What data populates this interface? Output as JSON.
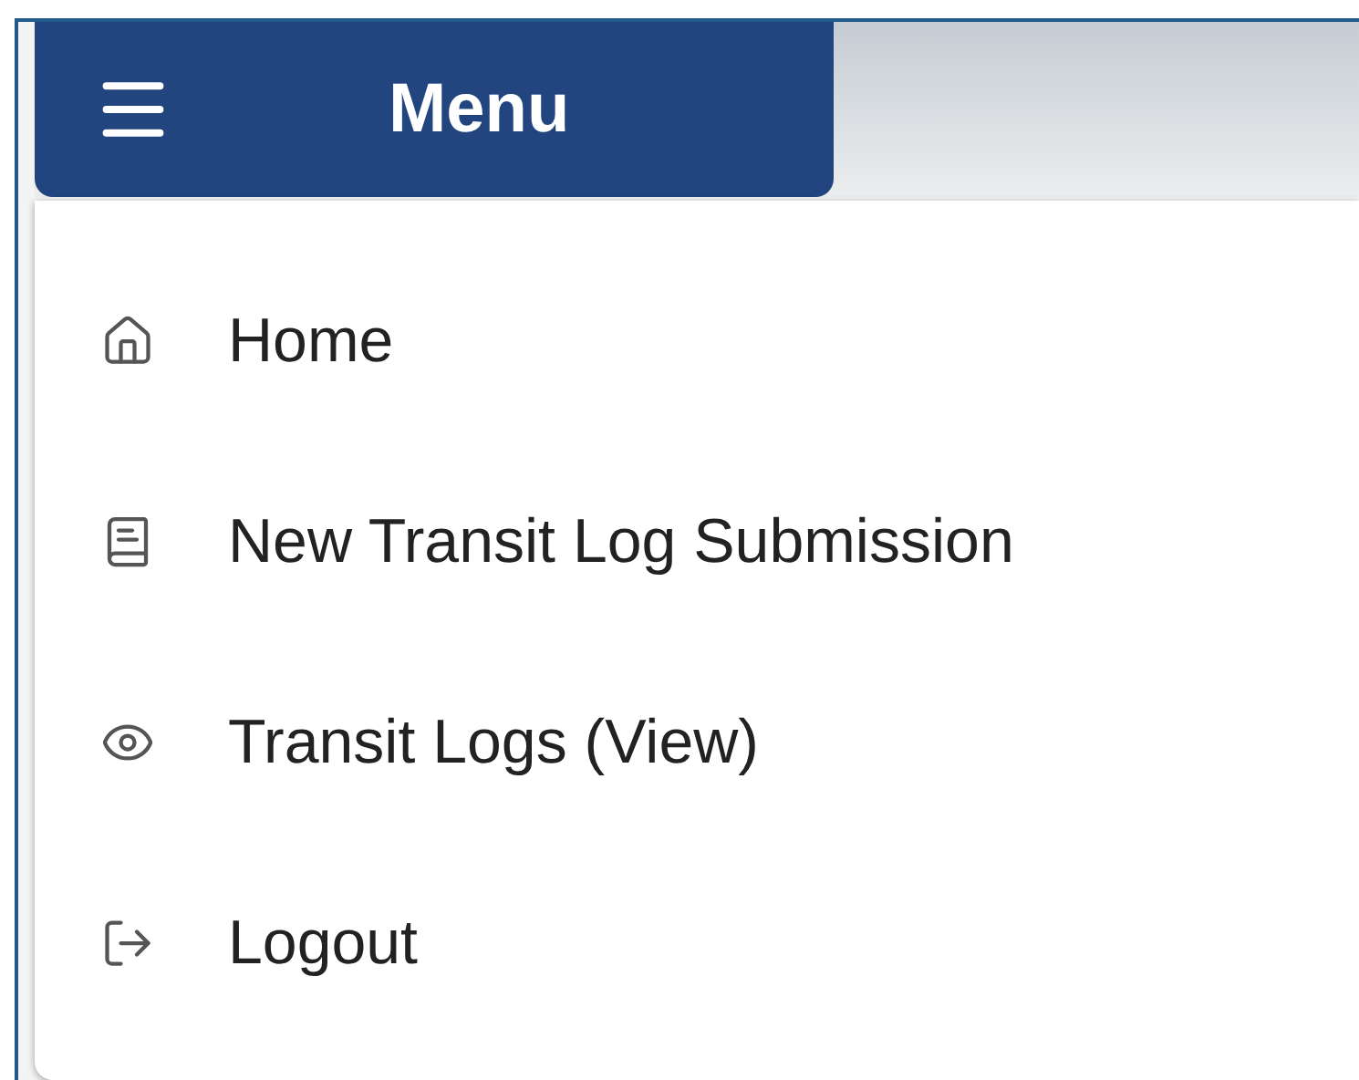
{
  "menu_button": {
    "label": "Menu"
  },
  "menu_items": [
    {
      "kind": "home",
      "label": "Home"
    },
    {
      "kind": "book",
      "label": "New Transit Log Submission"
    },
    {
      "kind": "eye",
      "label": "Transit Logs (View)"
    },
    {
      "kind": "logout",
      "label": "Logout"
    }
  ]
}
